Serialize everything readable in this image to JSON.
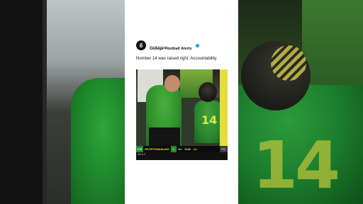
{
  "tweet": {
    "author_name": "College Football Alerts",
    "handle": "@CFBAlerts_",
    "text": "Number 14 was raised right. Accountability.",
    "avatar_letter": "6",
    "verified_color": "#1d9bf0"
  },
  "video": {
    "jersey_number": "14",
    "scorebug": {
      "team_left": "LO",
      "network": "SPORTSMANLIKE",
      "score_left": "",
      "team_right_mark": "O",
      "down": "3rd",
      "clock": "0:15",
      "quarter": "4th",
      "end_tag": "FS1"
    },
    "subbar": {
      "left": "4th & 2",
      "middle": "",
      "right": ""
    }
  },
  "colors": {
    "oregon_green": "#1f8a2c",
    "oregon_yellow": "#e8e020",
    "card_bg": "#ffffff"
  },
  "background_number": "14"
}
